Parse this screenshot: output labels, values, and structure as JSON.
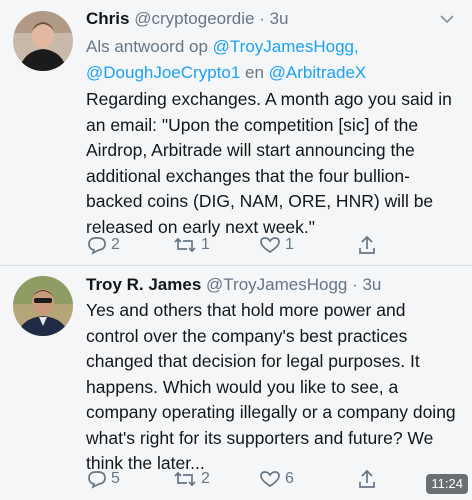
{
  "tweets": [
    {
      "name": "Chris",
      "handle": "@cryptogeordie",
      "separator": " · ",
      "time": "3u",
      "reply_prefix": "Als antwoord op ",
      "reply_mention_1": "@TroyJamesHogg,",
      "reply_mention_2": "@DoughJoeCrypto1",
      "reply_joiner": " en ",
      "reply_mention_3": "@ArbitradeX",
      "text": "Regarding exchanges. A month ago you said in an email: \"Upon the competition [sic] of the Airdrop, Arbitrade will start announcing the additional exchanges that the four bullion-backed coins (DIG, NAM, ORE, HNR) will be released on early next week.\"",
      "replies": "2",
      "retweets": "1",
      "likes": "1"
    },
    {
      "name": "Troy R. James",
      "handle": "@TroyJamesHogg",
      "separator": " · ",
      "time": "3u",
      "text": "Yes and others that hold more power and control over the company's best practices changed that decision for legal purposes. It happens. Which would you like to see, a company operating illegally or a company doing what's right for its supporters and future? We think the later...",
      "replies": "5",
      "retweets": "2",
      "likes": "6"
    }
  ],
  "status_bar": {
    "clock": "11:24"
  },
  "icons": {
    "reply": "reply-icon",
    "retweet": "retweet-icon",
    "like": "heart-icon",
    "share": "share-icon",
    "menu": "chevron-down-icon"
  },
  "colors": {
    "background": "#f4f6f7",
    "link": "#1da1f2",
    "muted": "#657786",
    "text": "#14171a"
  }
}
